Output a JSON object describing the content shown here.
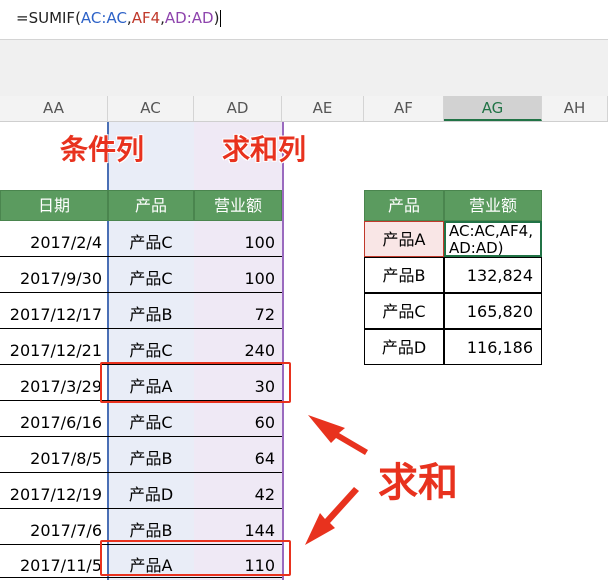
{
  "formula_bar": {
    "prefix": "=SUMIF(",
    "arg1": "AC:AC",
    "sep1": ",",
    "arg2": "AF4",
    "sep2": ",",
    "arg3": "AD:AD",
    "suffix": ")"
  },
  "columns": [
    "AA",
    "AC",
    "AD",
    "AE",
    "AF",
    "AG",
    "AH"
  ],
  "selected_column": "AG",
  "annotations": {
    "condition_col": "条件列",
    "sum_col": "求和列",
    "sum": "求和"
  },
  "left_table": {
    "headers": [
      "日期",
      "产品",
      "营业额"
    ],
    "rows": [
      [
        "2017/2/4",
        "产品C",
        "100"
      ],
      [
        "2017/9/30",
        "产品C",
        "100"
      ],
      [
        "2017/12/17",
        "产品B",
        "72"
      ],
      [
        "2017/12/21",
        "产品C",
        "240"
      ],
      [
        "2017/3/29",
        "产品A",
        "30"
      ],
      [
        "2017/6/16",
        "产品C",
        "60"
      ],
      [
        "2017/8/5",
        "产品B",
        "64"
      ],
      [
        "2017/12/19",
        "产品D",
        "42"
      ],
      [
        "2017/7/6",
        "产品B",
        "144"
      ],
      [
        "2017/11/5",
        "产品A",
        "110"
      ]
    ]
  },
  "right_table": {
    "headers": [
      "产品",
      "营业额"
    ],
    "rows": [
      [
        "产品A",
        "AC:AC,AF4,\nAD:AD)"
      ],
      [
        "产品B",
        "132,824"
      ],
      [
        "产品C",
        "165,820"
      ],
      [
        "产品D",
        "116,186"
      ]
    ]
  },
  "colors": {
    "header_green": "#5b9b5f",
    "annotation_red": "#e8321e",
    "formula_blue": "#2e63c8",
    "formula_red": "#c0392b",
    "formula_purple": "#8e44ad"
  }
}
